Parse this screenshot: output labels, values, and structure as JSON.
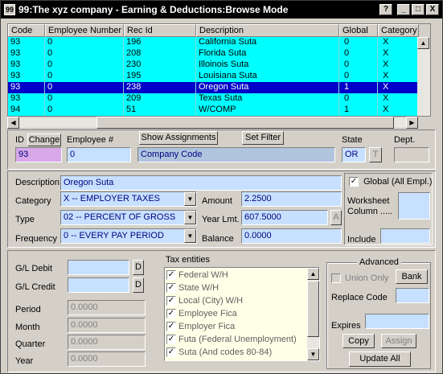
{
  "window": {
    "title": "99:The xyz company - Earning & Deductions:Browse Mode",
    "app_icon": "app-icon",
    "controls": [
      "?",
      "_",
      "□",
      "X"
    ]
  },
  "grid": {
    "columns": [
      "Code",
      "Employee Number",
      "Rec Id",
      "Description",
      "Global",
      "Category"
    ],
    "rows": [
      {
        "code": "93",
        "emp": "0",
        "rec": "196",
        "desc": "California Suta",
        "global": "0",
        "cat": "X",
        "selected": false
      },
      {
        "code": "93",
        "emp": "0",
        "rec": "208",
        "desc": "Florida Suta",
        "global": "0",
        "cat": "X",
        "selected": false
      },
      {
        "code": "93",
        "emp": "0",
        "rec": "230",
        "desc": "Illoinois Suta",
        "global": "0",
        "cat": "X",
        "selected": false
      },
      {
        "code": "93",
        "emp": "0",
        "rec": "195",
        "desc": "Louisiana Suta",
        "global": "0",
        "cat": "X",
        "selected": false
      },
      {
        "code": "93",
        "emp": "0",
        "rec": "238",
        "desc": "Oregon Suta",
        "global": "1",
        "cat": "X",
        "selected": true
      },
      {
        "code": "93",
        "emp": "0",
        "rec": "209",
        "desc": "Texas Suta",
        "global": "0",
        "cat": "X",
        "selected": false
      },
      {
        "code": "94",
        "emp": "0",
        "rec": "51",
        "desc": "W/COMP",
        "global": "1",
        "cat": "X",
        "selected": false
      }
    ]
  },
  "form": {
    "id_label": "ID",
    "change_button": "Change",
    "employee_label": "Employee #",
    "show_assignments_button": "Show Assignments",
    "set_filter_button": "Set Filter",
    "state_label": "State",
    "dept_label": "Dept.",
    "id_value": "93",
    "employee_value": "0",
    "company_code": "Company Code",
    "state_value": "OR",
    "state_button": "T",
    "dept_value": "",
    "description_label": "Description",
    "description_value": "Oregon Suta",
    "category_label": "Category",
    "category_value": "X -- EMPLOYER TAXES",
    "type_label": "Type",
    "type_value": "02 -- PERCENT OF GROSS",
    "frequency_label": "Frequency",
    "frequency_value": "0 -- EVERY PAY PERIOD",
    "amount_label": "Amount",
    "amount_value": "2.2500",
    "year_lmt_label": "Year Lmt.",
    "year_lmt_value": "607.5000",
    "year_lmt_button": "A",
    "balance_label": "Balance",
    "balance_value": "0.0000",
    "global_label": "Global (All Empl.)",
    "global_checked": true,
    "worksheet_label_1": "Worksheet",
    "worksheet_label_2": "Column .....",
    "include_label": "Include"
  },
  "ledger": {
    "gl_debit_label": "G/L Debit",
    "gl_credit_label": "G/L Credit",
    "d_button": "D",
    "period_label": "Period",
    "period_value": "0.0000",
    "month_label": "Month",
    "month_value": "0.0000",
    "quarter_label": "Quarter",
    "quarter_value": "0.0000",
    "year_label": "Year",
    "year_value": "0.0000"
  },
  "tax_entities": {
    "title": "Tax entities",
    "items": [
      {
        "label": "Federal W/H",
        "checked": true
      },
      {
        "label": "State W/H",
        "checked": true
      },
      {
        "label": "Local (City) W/H",
        "checked": true
      },
      {
        "label": "Employee Fica",
        "checked": true
      },
      {
        "label": "Employer Fica",
        "checked": true
      },
      {
        "label": "Futa (Federal Unemployment)",
        "checked": true
      },
      {
        "label": "Suta (And codes 80-84)",
        "checked": true
      }
    ]
  },
  "advanced": {
    "title": "Advanced",
    "union_only_label": "Union Only",
    "bank_button": "Bank",
    "replace_code_label": "Replace Code",
    "expires_label": "Expires",
    "copy_button": "Copy",
    "assign_button": "Assign",
    "update_all_button": "Update All"
  }
}
